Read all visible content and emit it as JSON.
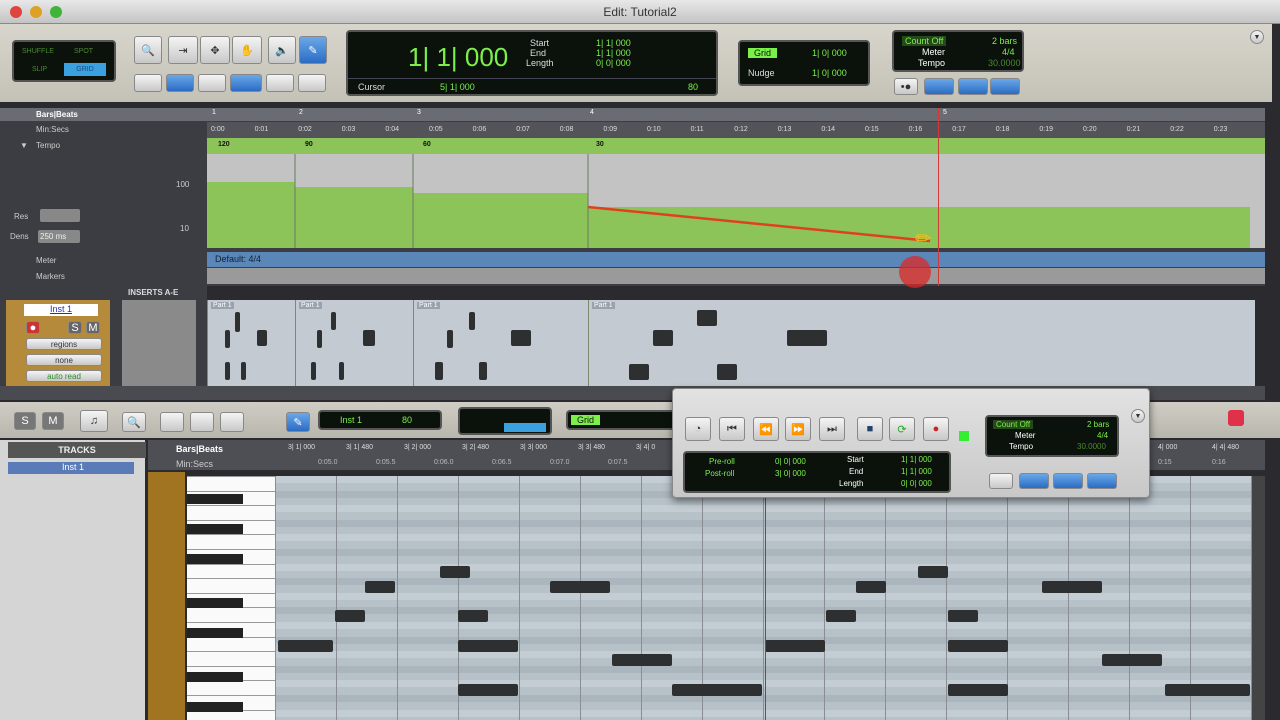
{
  "window": {
    "title": "Edit: Tutorial2"
  },
  "edit_modes": {
    "shuffle": "SHUFFLE",
    "spot": "SPOT",
    "slip": "SLIP",
    "grid": "GRID"
  },
  "counter": {
    "main": "1| 1| 000",
    "start_label": "Start",
    "end_label": "End",
    "length_label": "Length",
    "start": "1| 1| 000",
    "end": "1| 1| 000",
    "length": "0| 0| 000",
    "cursor_label": "Cursor",
    "cursor": "5| 1| 000",
    "nudge_value": "80"
  },
  "grid": {
    "grid_label": "Grid",
    "grid_value": "1| 0| 000",
    "nudge_label": "Nudge",
    "nudge_value": "1| 0| 000"
  },
  "countoff": {
    "label": "Count Off",
    "bars": "2 bars",
    "meter_label": "Meter",
    "meter": "4/4",
    "tempo_label": "Tempo",
    "tempo": "30.0000"
  },
  "rulers": {
    "bars_beats": "Bars|Beats",
    "min_secs": "Min:Secs",
    "tempo": "Tempo",
    "meter": "Meter",
    "markers": "Markers",
    "meter_default": "Default: 4/4",
    "scale_high": "100",
    "scale_low": "10",
    "res_label": "Res",
    "dens_label": "Dens",
    "dens_value": "250 ms",
    "bars": [
      "1",
      "2",
      "3",
      "4",
      "5"
    ],
    "times": [
      "0:00",
      "0:01",
      "0:02",
      "0:03",
      "0:04",
      "0:05",
      "0:06",
      "0:07",
      "0:08",
      "0:09",
      "0:10",
      "0:11",
      "0:12",
      "0:13",
      "0:14",
      "0:15",
      "0:16",
      "0:17",
      "0:18",
      "0:19",
      "0:20",
      "0:21",
      "0:22",
      "0:23"
    ],
    "tempo_events": [
      "120",
      "90",
      "60",
      "30"
    ]
  },
  "track": {
    "name": "Inst 1",
    "inserts": "INSERTS A-E",
    "view": "regions",
    "none": "none",
    "auto": "auto read",
    "solo": "S",
    "mute": "M",
    "clip_label": "Part 1"
  },
  "midi_editor": {
    "solo": "S",
    "mute": "M",
    "track_select": "Inst 1",
    "velocity": "80",
    "tracks_label": "TRACKS",
    "track_item": "Inst 1",
    "grid": "Grid",
    "bars_beats": "Bars|Beats",
    "min_secs": "Min:Secs",
    "bars": [
      "3| 1| 000",
      "3| 1| 480",
      "3| 2| 000",
      "3| 2| 480",
      "3| 3| 000",
      "3| 3| 480",
      "3| 4| 0"
    ],
    "bars_right": [
      "4| 000",
      "4| 4| 480"
    ],
    "times": [
      "0:05.0",
      "0:05.5",
      "0:06.0",
      "0:06.5",
      "0:07.0",
      "0:07.5"
    ],
    "times_right": [
      "0:15",
      "0:16"
    ]
  },
  "transport": {
    "preroll_label": "Pre-roll",
    "postroll_label": "Post-roll",
    "preroll": "0| 0| 000",
    "postroll": "3| 0| 000",
    "start_label": "Start",
    "end_label": "End",
    "length_label": "Length",
    "start": "1| 1| 000",
    "end": "1| 1| 000",
    "length": "0| 0| 000",
    "countoff": "Count Off",
    "bars": "2 bars",
    "meter_label": "Meter",
    "meter": "4/4",
    "tempo_label": "Tempo",
    "tempo": "30.0000"
  },
  "colors": {
    "lcd_green": "#7cf04a",
    "tempo_fill": "#8cc45a",
    "playhead": "#d23a3a",
    "meter_bar": "#5a86b8"
  }
}
